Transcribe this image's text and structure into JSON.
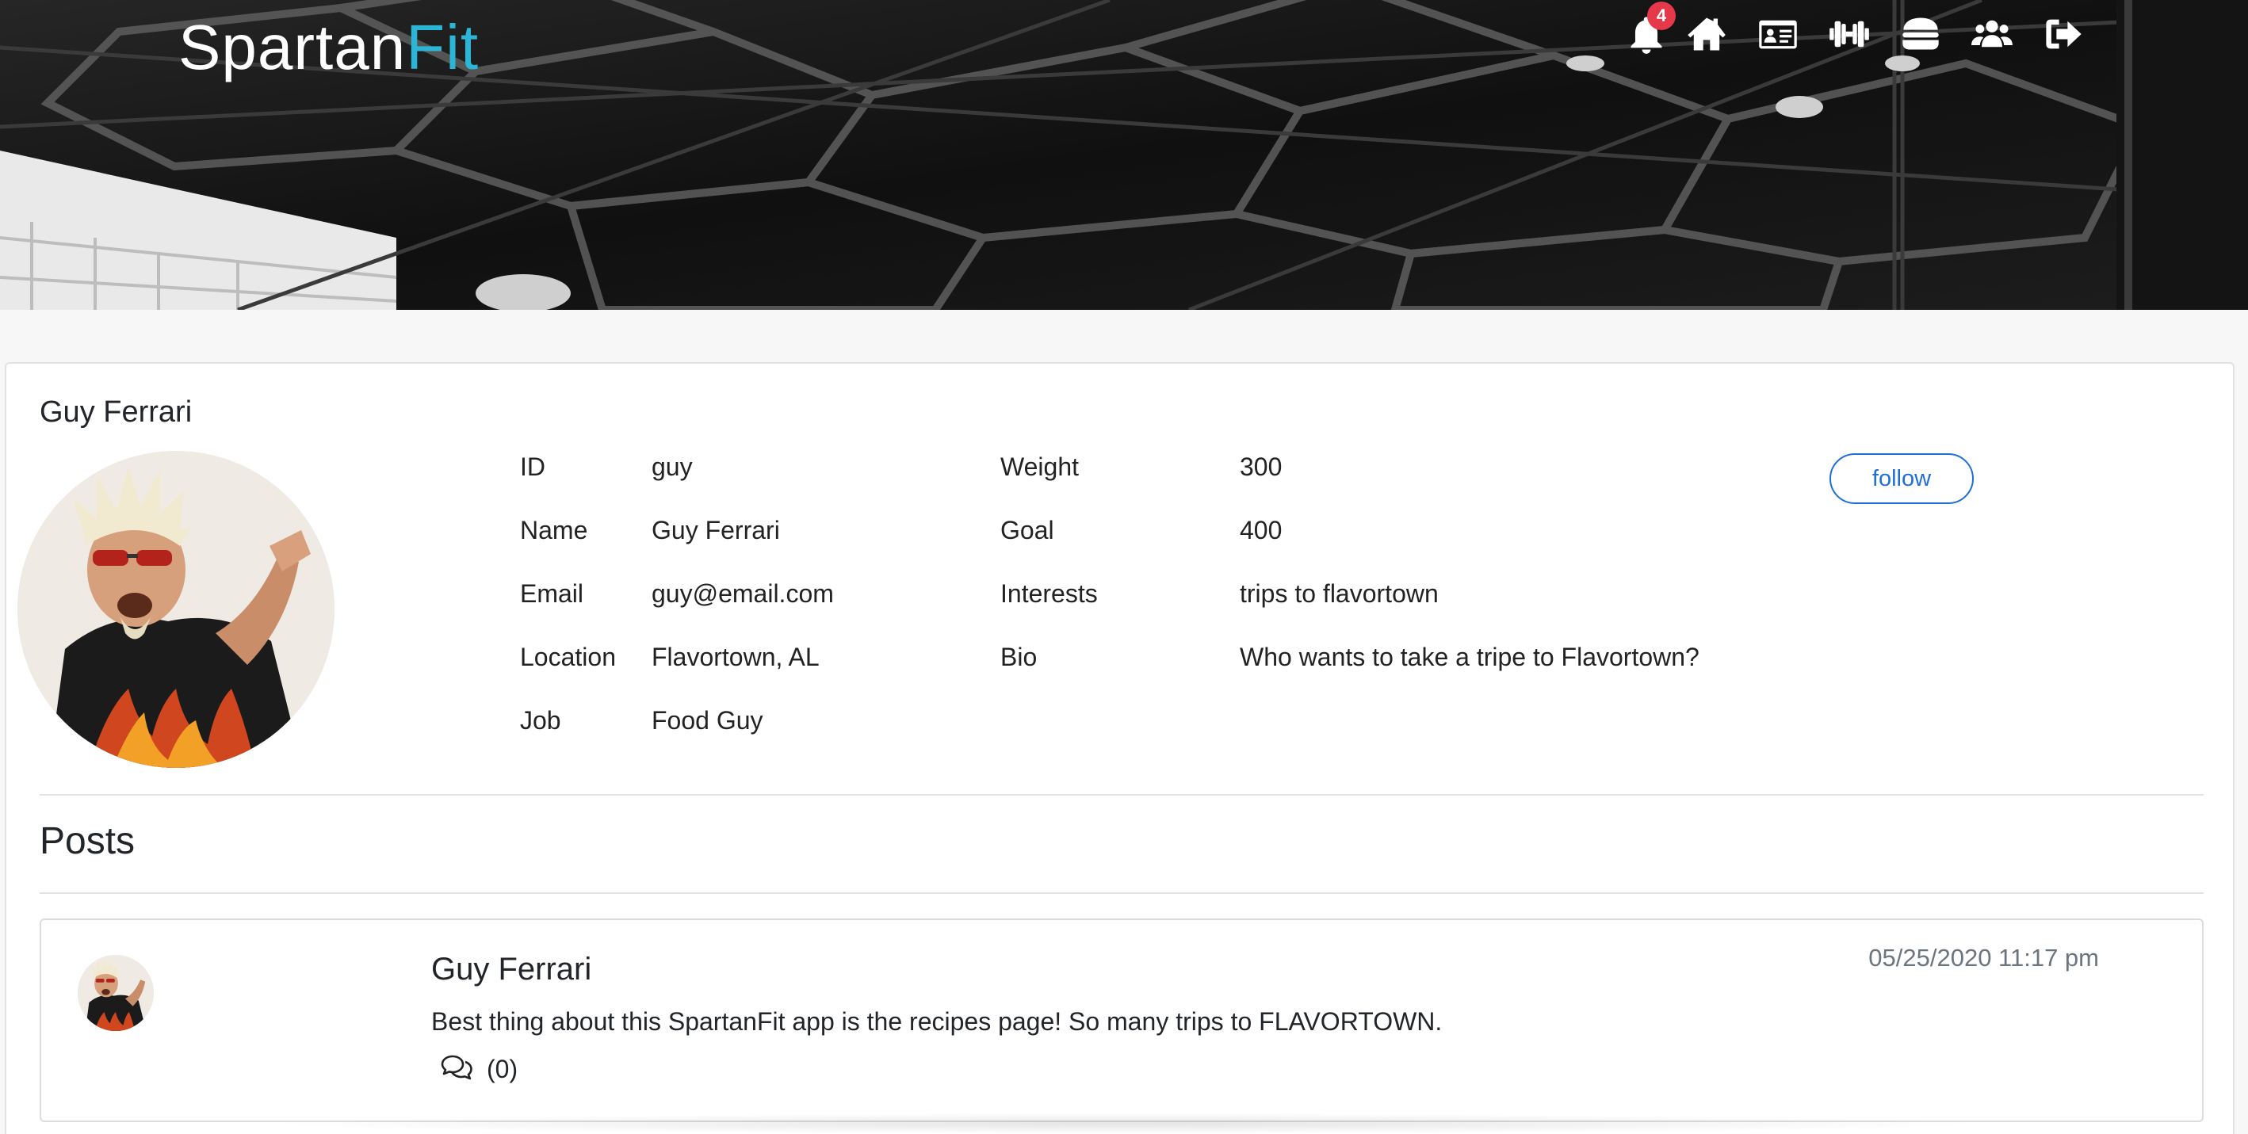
{
  "header": {
    "brand_part1": "Spartan",
    "brand_part2": "Fit",
    "brand_color": "#2bb5d6",
    "notification_count": "4",
    "nav_icons": [
      "bell-icon",
      "home-icon",
      "profile-card-icon",
      "dumbbell-icon",
      "burger-icon",
      "users-icon",
      "sign-out-icon"
    ]
  },
  "profile": {
    "name": "Guy Ferrari",
    "details_left": [
      {
        "label": "ID",
        "value": "guy"
      },
      {
        "label": "Name",
        "value": "Guy Ferrari"
      },
      {
        "label": "Email",
        "value": "guy@email.com"
      },
      {
        "label": "Location",
        "value": "Flavortown, AL"
      },
      {
        "label": "Job",
        "value": "Food Guy"
      }
    ],
    "details_right": [
      {
        "label": "Weight",
        "value": "300"
      },
      {
        "label": "Goal",
        "value": "400"
      },
      {
        "label": "Interests",
        "value": "trips to flavortown"
      },
      {
        "label": "Bio",
        "value": "Who wants to take a tripe to Flavortown?"
      }
    ],
    "follow_label": "follow"
  },
  "posts": {
    "title": "Posts",
    "items": [
      {
        "author": "Guy Ferrari",
        "date": "05/25/2020 11:17 pm",
        "text": "Best thing about this SpartanFit app is the recipes page! So many trips to FLAVORTOWN.",
        "comments": "(0)"
      }
    ]
  },
  "colors": {
    "accent": "#2bb5d6",
    "follow_button": "#1f6fd8",
    "badge": "#e53848"
  }
}
